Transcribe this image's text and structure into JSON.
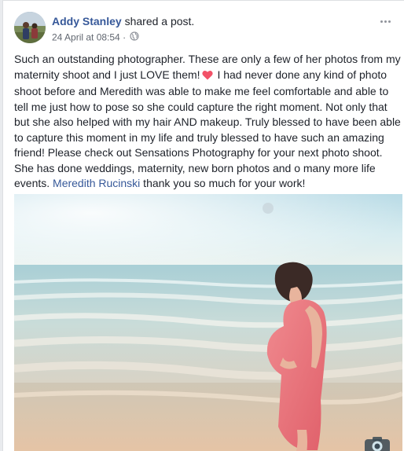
{
  "post": {
    "author": "Addy Stanley",
    "action": " shared a post.",
    "timestamp": "24 April at 08:54",
    "separator": " · ",
    "privacy_icon": "globe-icon",
    "more_icon": "more-options-icon",
    "text_part1": "Such an outstanding photographer. These are only a few of her photos from my maternity shoot and I just LOVE them!",
    "heart_icon": "heart-icon",
    "text_part2": " I had never done any kind of photo shoot before and Meredith was able to make me feel comfortable and able to tell me just how to pose so she could capture the right moment. Not only that but she also helped with my hair AND makeup. Truly blessed to have been able to capture this moment in my life and truly blessed to have such an amazing friend! Please check out Sensations Photography for your next photo shoot. She has done weddings, maternity, new born photos and o many more life events. ",
    "mention": "Meredith Rucinski",
    "text_part3": " thank you so much for your work!",
    "photo_watermark_icon": "camera-watermark-icon"
  },
  "colors": {
    "link": "#365899",
    "text": "#1d2129",
    "meta": "#616770",
    "heart": "#f25268"
  }
}
